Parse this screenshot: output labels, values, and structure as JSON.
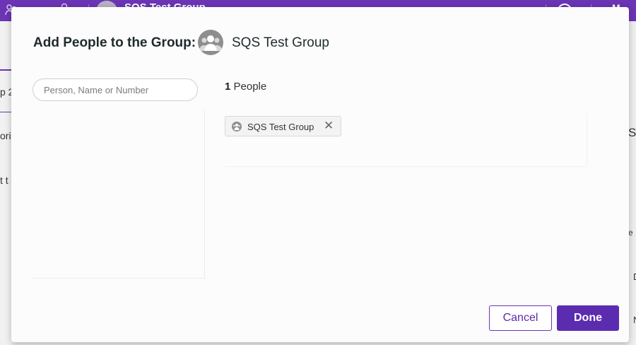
{
  "background_app": {
    "group_title": "SQS Test Group",
    "right_fragment": "M",
    "left_fragments": [
      "p 2",
      "ori",
      "t t"
    ],
    "right_side_fragments": [
      "S",
      "e",
      "D",
      "N"
    ]
  },
  "dialog": {
    "title": "Add People to the Group:",
    "group_name": "SQS Test Group",
    "search": {
      "placeholder": "Person, Name or Number",
      "value": ""
    },
    "people_count": "1",
    "people_label": "People",
    "selected": [
      {
        "label": "SQS Test Group",
        "remove_icon": "close-icon"
      }
    ],
    "buttons": {
      "cancel": "Cancel",
      "done": "Done"
    }
  },
  "colors": {
    "accent": "#6b35b5",
    "done_bg": "#5b2cb0"
  }
}
